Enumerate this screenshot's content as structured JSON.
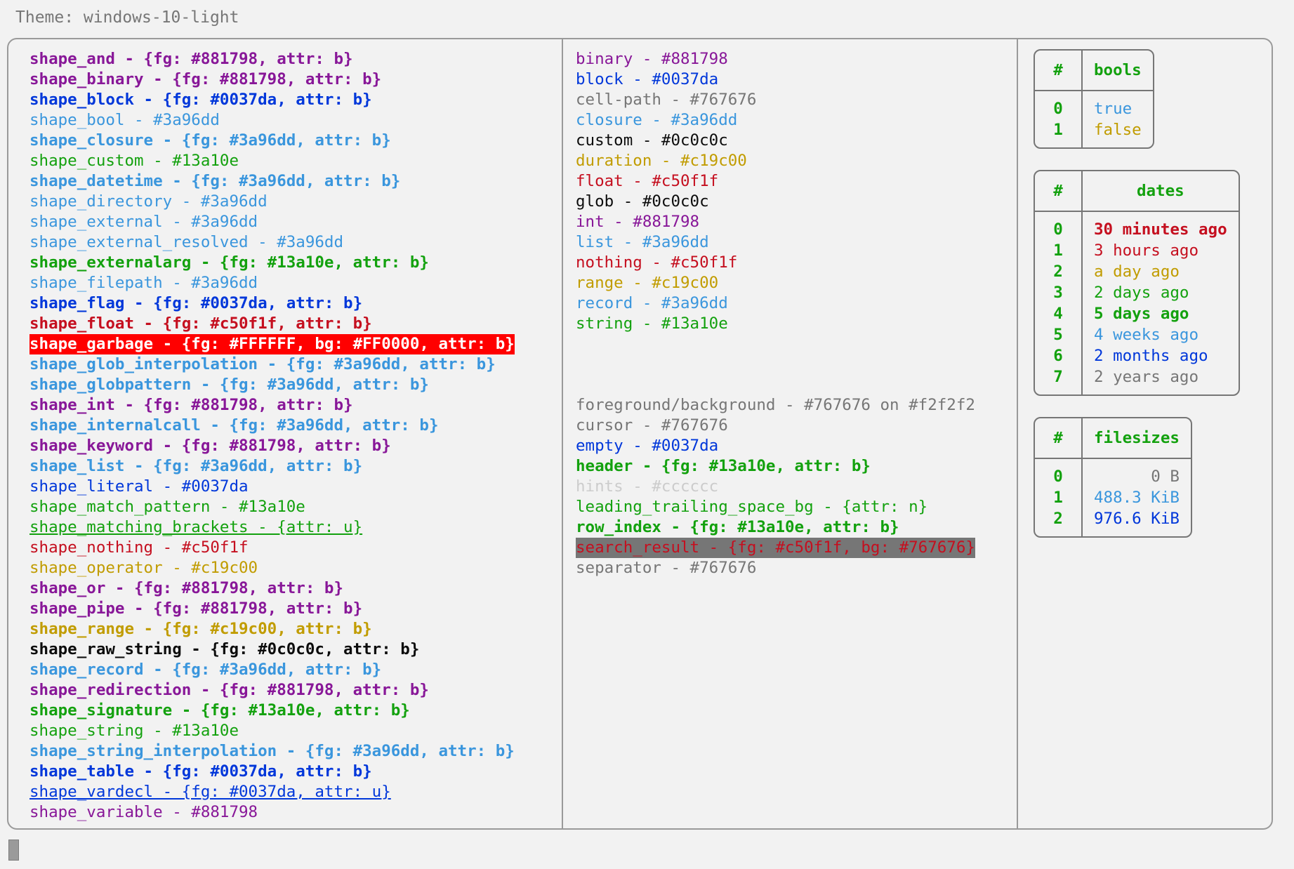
{
  "theme": {
    "label": "Theme: windows-10-light"
  },
  "colors": {
    "purple": "#881798",
    "blue": "#0037da",
    "lightblue": "#3a96dd",
    "green": "#13a10e",
    "red": "#c50f1f",
    "yellow": "#c19c00",
    "black": "#0c0c0c",
    "gray": "#767676",
    "lightgray": "#cccccc",
    "background": "#f2f2f2",
    "garbage_fg": "#FFFFFF",
    "garbage_bg": "#FF0000"
  },
  "left_column": {
    "name": "shapes",
    "lines": [
      {
        "text": "shape_and - {fg: #881798, attr: b}",
        "color": "#881798",
        "bold": true
      },
      {
        "text": "shape_binary - {fg: #881798, attr: b}",
        "color": "#881798",
        "bold": true
      },
      {
        "text": "shape_block - {fg: #0037da, attr: b}",
        "color": "#0037da",
        "bold": true
      },
      {
        "text": "shape_bool - #3a96dd",
        "color": "#3a96dd",
        "bold": false
      },
      {
        "text": "shape_closure - {fg: #3a96dd, attr: b}",
        "color": "#3a96dd",
        "bold": true
      },
      {
        "text": "shape_custom - #13a10e",
        "color": "#13a10e",
        "bold": false
      },
      {
        "text": "shape_datetime - {fg: #3a96dd, attr: b}",
        "color": "#3a96dd",
        "bold": true
      },
      {
        "text": "shape_directory - #3a96dd",
        "color": "#3a96dd",
        "bold": false
      },
      {
        "text": "shape_external - #3a96dd",
        "color": "#3a96dd",
        "bold": false
      },
      {
        "text": "shape_external_resolved - #3a96dd",
        "color": "#3a96dd",
        "bold": false
      },
      {
        "text": "shape_externalarg - {fg: #13a10e, attr: b}",
        "color": "#13a10e",
        "bold": true
      },
      {
        "text": "shape_filepath - #3a96dd",
        "color": "#3a96dd",
        "bold": false
      },
      {
        "text": "shape_flag - {fg: #0037da, attr: b}",
        "color": "#0037da",
        "bold": true
      },
      {
        "text": "shape_float - {fg: #c50f1f, attr: b}",
        "color": "#c50f1f",
        "bold": true
      },
      {
        "text": "shape_garbage - {fg: #FFFFFF, bg: #FF0000, attr: b}",
        "color": "#FFFFFF",
        "bg": "#FF0000",
        "bold": true
      },
      {
        "text": "shape_glob_interpolation - {fg: #3a96dd, attr: b}",
        "color": "#3a96dd",
        "bold": true
      },
      {
        "text": "shape_globpattern - {fg: #3a96dd, attr: b}",
        "color": "#3a96dd",
        "bold": true
      },
      {
        "text": "shape_int - {fg: #881798, attr: b}",
        "color": "#881798",
        "bold": true
      },
      {
        "text": "shape_internalcall - {fg: #3a96dd, attr: b}",
        "color": "#3a96dd",
        "bold": true
      },
      {
        "text": "shape_keyword - {fg: #881798, attr: b}",
        "color": "#881798",
        "bold": true
      },
      {
        "text": "shape_list - {fg: #3a96dd, attr: b}",
        "color": "#3a96dd",
        "bold": true
      },
      {
        "text": "shape_literal - #0037da",
        "color": "#0037da",
        "bold": false
      },
      {
        "text": "shape_match_pattern - #13a10e",
        "color": "#13a10e",
        "bold": false
      },
      {
        "text": "shape_matching_brackets - {attr: u}",
        "color": "#13a10e",
        "bold": false,
        "underline": true
      },
      {
        "text": "shape_nothing - #c50f1f",
        "color": "#c50f1f",
        "bold": false
      },
      {
        "text": "shape_operator - #c19c00",
        "color": "#c19c00",
        "bold": false
      },
      {
        "text": "shape_or - {fg: #881798, attr: b}",
        "color": "#881798",
        "bold": true
      },
      {
        "text": "shape_pipe - {fg: #881798, attr: b}",
        "color": "#881798",
        "bold": true
      },
      {
        "text": "shape_range - {fg: #c19c00, attr: b}",
        "color": "#c19c00",
        "bold": true
      },
      {
        "text": "shape_raw_string - {fg: #0c0c0c, attr: b}",
        "color": "#0c0c0c",
        "bold": true
      },
      {
        "text": "shape_record - {fg: #3a96dd, attr: b}",
        "color": "#3a96dd",
        "bold": true
      },
      {
        "text": "shape_redirection - {fg: #881798, attr: b}",
        "color": "#881798",
        "bold": true
      },
      {
        "text": "shape_signature - {fg: #13a10e, attr: b}",
        "color": "#13a10e",
        "bold": true
      },
      {
        "text": "shape_string - #13a10e",
        "color": "#13a10e",
        "bold": false
      },
      {
        "text": "shape_string_interpolation - {fg: #3a96dd, attr: b}",
        "color": "#3a96dd",
        "bold": true
      },
      {
        "text": "shape_table - {fg: #0037da, attr: b}",
        "color": "#0037da",
        "bold": true
      },
      {
        "text": "shape_vardecl - {fg: #0037da, attr: u}",
        "color": "#0037da",
        "bold": false,
        "underline": true
      },
      {
        "text": "shape_variable - #881798",
        "color": "#881798",
        "bold": false
      }
    ]
  },
  "middle_column": {
    "name": "types-and-ui",
    "group_types": [
      {
        "text": "binary - #881798",
        "color": "#881798",
        "bold": false
      },
      {
        "text": "block - #0037da",
        "color": "#0037da",
        "bold": false
      },
      {
        "text": "cell-path - #767676",
        "color": "#767676",
        "bold": false
      },
      {
        "text": "closure - #3a96dd",
        "color": "#3a96dd",
        "bold": false
      },
      {
        "text": "custom - #0c0c0c",
        "color": "#0c0c0c",
        "bold": false
      },
      {
        "text": "duration - #c19c00",
        "color": "#c19c00",
        "bold": false
      },
      {
        "text": "float - #c50f1f",
        "color": "#c50f1f",
        "bold": false
      },
      {
        "text": "glob - #0c0c0c",
        "color": "#0c0c0c",
        "bold": false
      },
      {
        "text": "int - #881798",
        "color": "#881798",
        "bold": false
      },
      {
        "text": "list - #3a96dd",
        "color": "#3a96dd",
        "bold": false
      },
      {
        "text": "nothing - #c50f1f",
        "color": "#c50f1f",
        "bold": false
      },
      {
        "text": "range - #c19c00",
        "color": "#c19c00",
        "bold": false
      },
      {
        "text": "record - #3a96dd",
        "color": "#3a96dd",
        "bold": false
      },
      {
        "text": "string - #13a10e",
        "color": "#13a10e",
        "bold": false
      }
    ],
    "group_ui": [
      {
        "text": "foreground/background - #767676 on #f2f2f2",
        "color": "#767676",
        "bold": false
      },
      {
        "text": "cursor - #767676",
        "color": "#767676",
        "bold": false
      },
      {
        "text": "empty - #0037da",
        "color": "#0037da",
        "bold": false
      },
      {
        "text": "header - {fg: #13a10e, attr: b}",
        "color": "#13a10e",
        "bold": true
      },
      {
        "text": "hints - #cccccc",
        "color": "#cccccc",
        "bold": false
      },
      {
        "text": "leading_trailing_space_bg - {attr: n}",
        "color": "#13a10e",
        "bold": false
      },
      {
        "text": "row_index - {fg: #13a10e, attr: b}",
        "color": "#13a10e",
        "bold": true
      },
      {
        "text": "search_result - {fg: #c50f1f, bg: #767676}",
        "color": "#c50f1f",
        "bg": "#767676",
        "bold": false
      },
      {
        "text": "separator - #767676",
        "color": "#767676",
        "bold": false
      }
    ]
  },
  "right_column": {
    "tables": [
      {
        "name": "bools",
        "index_header": "#",
        "value_header": "bools",
        "align": "left",
        "rows": [
          {
            "index": "0",
            "value": "true",
            "color": "#3a96dd",
            "bold": false
          },
          {
            "index": "1",
            "value": "false",
            "color": "#c19c00",
            "bold": false
          }
        ]
      },
      {
        "name": "dates",
        "index_header": "#",
        "value_header": "dates",
        "align": "left",
        "rows": [
          {
            "index": "0",
            "value": "30 minutes ago",
            "color": "#c50f1f",
            "bold": true
          },
          {
            "index": "1",
            "value": "3 hours ago",
            "color": "#c50f1f",
            "bold": false
          },
          {
            "index": "2",
            "value": "a day ago",
            "color": "#c19c00",
            "bold": false
          },
          {
            "index": "3",
            "value": "2 days ago",
            "color": "#13a10e",
            "bold": false
          },
          {
            "index": "4",
            "value": "5 days ago",
            "color": "#13a10e",
            "bold": true
          },
          {
            "index": "5",
            "value": "4 weeks ago",
            "color": "#3a96dd",
            "bold": false
          },
          {
            "index": "6",
            "value": "2 months ago",
            "color": "#0037da",
            "bold": false
          },
          {
            "index": "7",
            "value": "2 years ago",
            "color": "#767676",
            "bold": false
          }
        ]
      },
      {
        "name": "filesizes",
        "index_header": "#",
        "value_header": "filesizes",
        "align": "right",
        "rows": [
          {
            "index": "0",
            "value": "0 B",
            "color": "#767676",
            "bold": false
          },
          {
            "index": "1",
            "value": "488.3 KiB",
            "color": "#3a96dd",
            "bold": false
          },
          {
            "index": "2",
            "value": "976.6 KiB",
            "color": "#0037da",
            "bold": false
          }
        ]
      }
    ]
  }
}
